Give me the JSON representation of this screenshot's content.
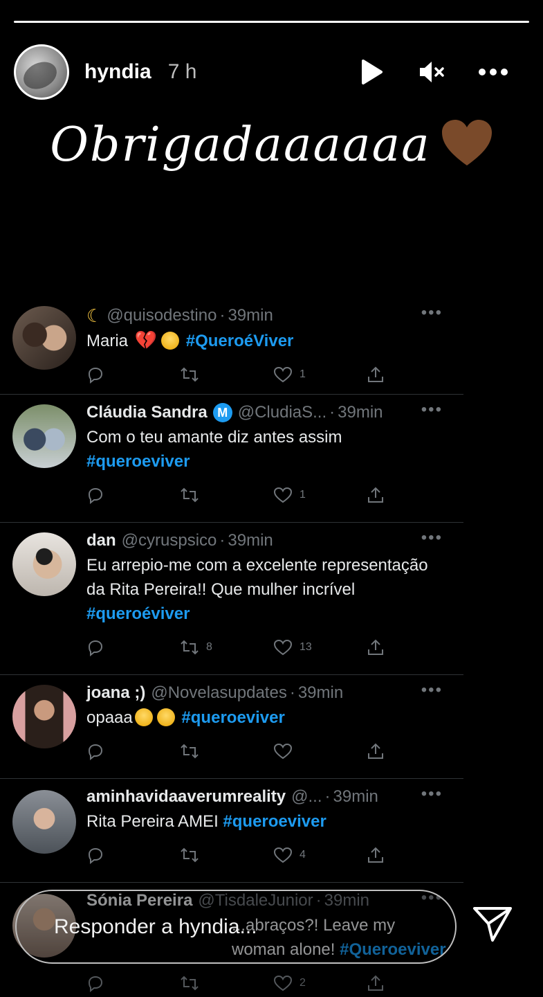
{
  "story": {
    "progress": 1.0,
    "username": "hyndia",
    "time": "7 h",
    "caption": "Obrigadaaaaaa",
    "heart_color": "#7a4a2a"
  },
  "tweets": [
    {
      "prefix_icon": "moon-icon",
      "name": "",
      "handle": "@quisodestino",
      "time": "39min",
      "text": "Maria",
      "hashtag": "#QueroéViver",
      "retweets": "",
      "likes": "1"
    },
    {
      "name": "Cláudia Sandra",
      "verified_badge": "M",
      "handle": "@CludiaS...",
      "time": "39min",
      "text": "Com o teu amante diz antes assim",
      "hashtag": "#queroeviver",
      "retweets": "",
      "likes": "1"
    },
    {
      "name": "dan",
      "handle": "@cyruspsico",
      "time": "39min",
      "text": "Eu arrepio-me com a excelente representação da Rita Pereira!! Que mulher incrível",
      "hashtag": "#queroéviver",
      "retweets": "8",
      "likes": "13"
    },
    {
      "name": "joana ;)",
      "handle": "@Novelasupdates",
      "time": "39min",
      "text": "opaaa",
      "hashtag": "#queroeviver",
      "retweets": "",
      "likes": ""
    },
    {
      "name": "aminhavidaaverumreality",
      "handle": "@...",
      "time": "39min",
      "text": "Rita Pereira AMEI",
      "hashtag": "#queroeviver",
      "retweets": "",
      "likes": "4"
    },
    {
      "name": "Sónia Pereira",
      "handle": "@TisdaleJunior",
      "time": "39min",
      "text": "...abraços?! Leave my woman alone!",
      "hashtag": "#Queroeviver",
      "retweets": "",
      "likes": "2"
    }
  ],
  "reply": {
    "placeholder": "Responder a hyndia..."
  },
  "colors": {
    "background": "#000000",
    "hashtag": "#1d9bf0",
    "muted": "#71767b",
    "text": "#e7e9ea"
  }
}
